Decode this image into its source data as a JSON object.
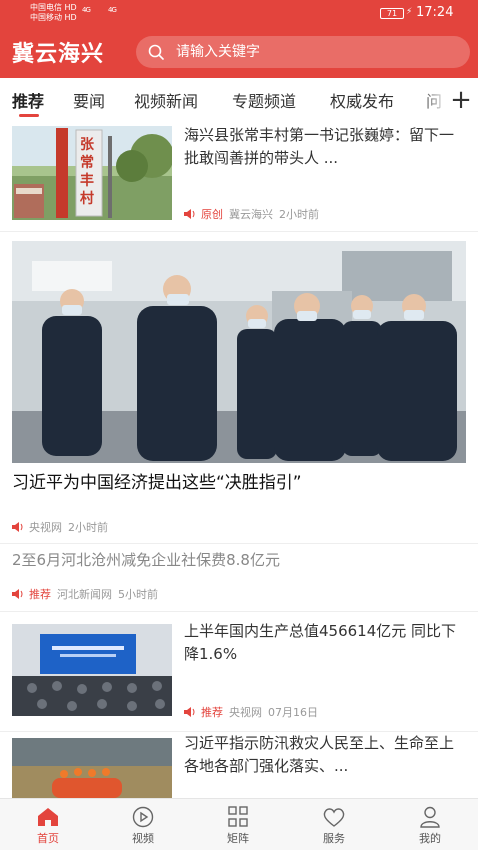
{
  "status_bar": {
    "carrier1": "中国电信 HD",
    "carrier2": "中国移动 HD",
    "signal1": "4G",
    "signal2": "4G",
    "battery": "71",
    "time": "17:24"
  },
  "header": {
    "app_name": "冀云海兴",
    "search_placeholder": "请输入关键字"
  },
  "tabs": [
    "推荐",
    "要闻",
    "视频新闻",
    "专题频道",
    "权威发布",
    "问"
  ],
  "active_tab": 0,
  "feed": [
    {
      "title": "海兴县张常丰村第一书记张巍婷：留下一批敢闯善拼的带头人 ...",
      "tag": "原创",
      "source": "冀云海兴",
      "time": "2小时前",
      "image_text": "张常丰村"
    },
    {
      "title": "习近平为中国经济提出这些“决胜指引”",
      "tag": "",
      "source": "央视网",
      "time": "2小时前"
    },
    {
      "title": "2至6月河北沧州减免企业社保费8.8亿元",
      "tag": "推荐",
      "source": "河北新闻网",
      "time": "5小时前"
    },
    {
      "title": "上半年国内生产总值456614亿元 同比下降1.6%",
      "tag": "推荐",
      "source": "央视网",
      "time": "07月16日"
    },
    {
      "title": "习近平指示防汛救灾人民至上、生命至上 各地各部门强化落实、...",
      "tag": "",
      "source": "",
      "time": ""
    }
  ],
  "bottom_nav": [
    {
      "label": "首页",
      "icon": "home-icon"
    },
    {
      "label": "视频",
      "icon": "play-icon"
    },
    {
      "label": "矩阵",
      "icon": "grid-icon"
    },
    {
      "label": "服务",
      "icon": "heart-icon"
    },
    {
      "label": "我的",
      "icon": "user-icon"
    }
  ],
  "colors": {
    "accent": "#e3443d"
  }
}
